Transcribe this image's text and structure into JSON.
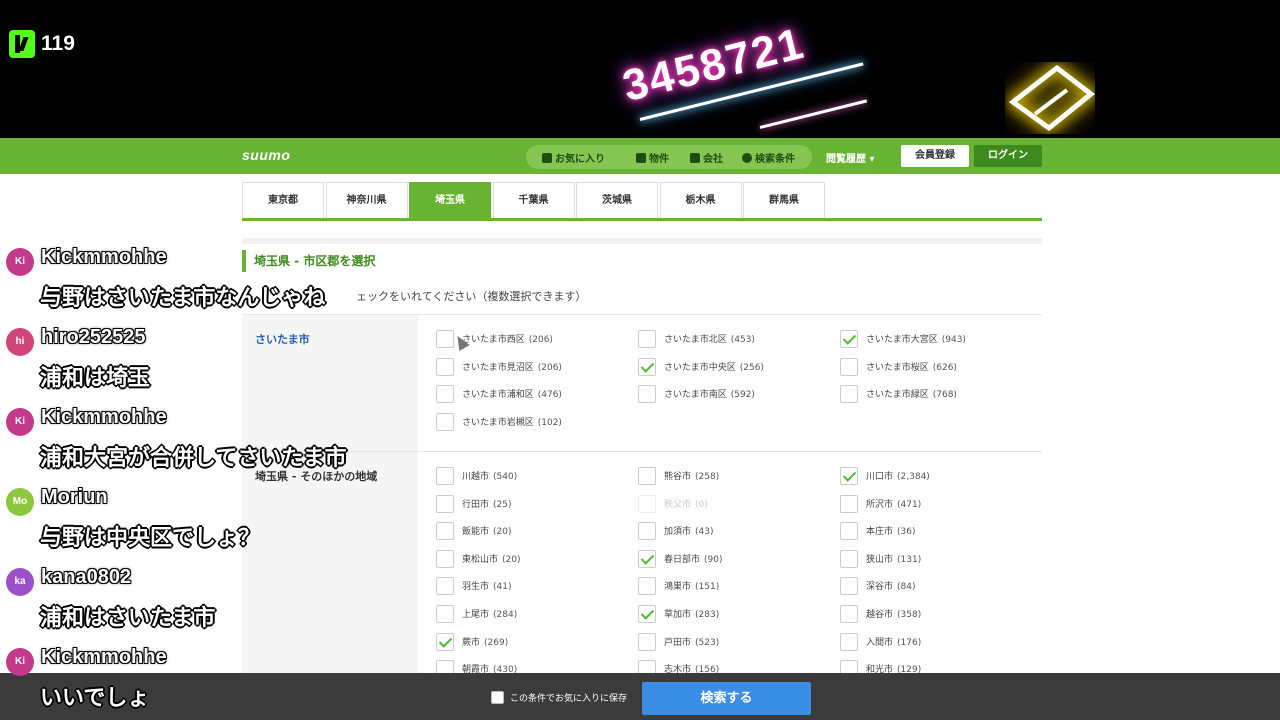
{
  "stream": {
    "viewer_count": "119",
    "neon_text": "3458721"
  },
  "site": {
    "logo": "suumo",
    "nav": {
      "favorites": "お気に入り",
      "property": "物件",
      "company": "会社",
      "search_conditions": "検索条件",
      "history": "閲覧履歴 ▾",
      "register": "会員登録",
      "login": "ログイン"
    },
    "prefecture_tabs": [
      {
        "label": "東京都",
        "active": false
      },
      {
        "label": "神奈川県",
        "active": false
      },
      {
        "label": "埼玉県",
        "active": true
      },
      {
        "label": "千葉県",
        "active": false
      },
      {
        "label": "茨城県",
        "active": false
      },
      {
        "label": "栃木県",
        "active": false
      },
      {
        "label": "群馬県",
        "active": false
      }
    ],
    "section_title": "埼玉県 - 市区郡を選択",
    "instruction": "ェックをいれてください（複数選択できます）",
    "groups": [
      {
        "label": "さいたま市",
        "is_link": true,
        "options": [
          {
            "name": "さいたま市西区",
            "count": "(206)",
            "checked": false
          },
          {
            "name": "さいたま市北区",
            "count": "(453)",
            "checked": false
          },
          {
            "name": "さいたま市大宮区",
            "count": "(943)",
            "checked": true
          },
          {
            "name": "さいたま市見沼区",
            "count": "(206)",
            "checked": false
          },
          {
            "name": "さいたま市中央区",
            "count": "(256)",
            "checked": true
          },
          {
            "name": "さいたま市桜区",
            "count": "(626)",
            "checked": false
          },
          {
            "name": "さいたま市浦和区",
            "count": "(476)",
            "checked": false
          },
          {
            "name": "さいたま市南区",
            "count": "(592)",
            "checked": false
          },
          {
            "name": "さいたま市緑区",
            "count": "(768)",
            "checked": false
          },
          {
            "name": "さいたま市岩槻区",
            "count": "(102)",
            "checked": false
          }
        ]
      },
      {
        "label": "埼玉県 - そのほかの地域",
        "is_link": false,
        "options": [
          {
            "name": "川越市",
            "count": "(540)",
            "checked": false
          },
          {
            "name": "熊谷市",
            "count": "(258)",
            "checked": false
          },
          {
            "name": "川口市",
            "count": "(2,384)",
            "checked": true
          },
          {
            "name": "行田市",
            "count": "(25)",
            "checked": false
          },
          {
            "name": "秩父市",
            "count": "(0)",
            "checked": false,
            "disabled": true
          },
          {
            "name": "所沢市",
            "count": "(471)",
            "checked": false
          },
          {
            "name": "飯能市",
            "count": "(20)",
            "checked": false
          },
          {
            "name": "加須市",
            "count": "(43)",
            "checked": false
          },
          {
            "name": "本庄市",
            "count": "(36)",
            "checked": false
          },
          {
            "name": "東松山市",
            "count": "(20)",
            "checked": false
          },
          {
            "name": "春日部市",
            "count": "(90)",
            "checked": true
          },
          {
            "name": "狭山市",
            "count": "(131)",
            "checked": false
          },
          {
            "name": "羽生市",
            "count": "(41)",
            "checked": false
          },
          {
            "name": "鴻巣市",
            "count": "(151)",
            "checked": false
          },
          {
            "name": "深谷市",
            "count": "(84)",
            "checked": false
          },
          {
            "name": "上尾市",
            "count": "(284)",
            "checked": false
          },
          {
            "name": "草加市",
            "count": "(283)",
            "checked": true
          },
          {
            "name": "越谷市",
            "count": "(358)",
            "checked": false
          },
          {
            "name": "蕨市",
            "count": "(269)",
            "checked": true
          },
          {
            "name": "戸田市",
            "count": "(523)",
            "checked": false
          },
          {
            "name": "入間市",
            "count": "(176)",
            "checked": false
          },
          {
            "name": "朝霞市",
            "count": "(430)",
            "checked": false
          },
          {
            "name": "志木市",
            "count": "(156)",
            "checked": false
          },
          {
            "name": "和光市",
            "count": "(129)",
            "checked": false
          }
        ]
      }
    ],
    "footer": {
      "save_label": "この条件でお気に入りに保存",
      "search_button": "検索する"
    }
  },
  "chat": [
    {
      "initials": "Ki",
      "color": "#c2398a",
      "username": "Kickmmohhe",
      "message": "与野はさいたま市なんじゃね"
    },
    {
      "initials": "hi",
      "color": "#d0467a",
      "username": "hiro252525",
      "message": "浦和は埼玉"
    },
    {
      "initials": "Ki",
      "color": "#c2398a",
      "username": "Kickmmohhe",
      "message": "浦和大宮が合併してさいたま市"
    },
    {
      "initials": "Mo",
      "color": "#8dc63f",
      "username": "Moriun",
      "message": "与野は中央区でしょ？"
    },
    {
      "initials": "ka",
      "color": "#9b4fc8",
      "username": "kana0802",
      "message": "浦和はさいたま市"
    },
    {
      "initials": "Ki",
      "color": "#c2398a",
      "username": "Kickmmohhe",
      "message": "いいでしょ"
    }
  ]
}
